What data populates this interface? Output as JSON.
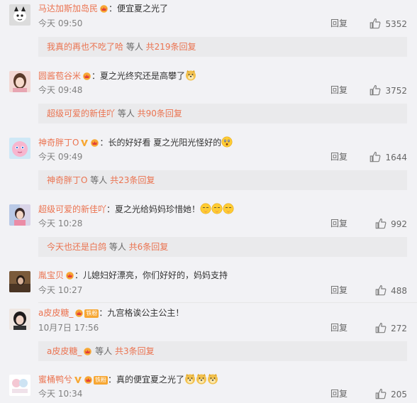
{
  "comments": [
    {
      "username": "马达加斯加岛民",
      "text": "：便宜夏之光了",
      "time": "今天 09:50",
      "reply_label": "回复",
      "likes": "5352",
      "sub": {
        "user": "我真的再也不吃了哈",
        "mid": " 等人 ",
        "count": "共219条回复"
      }
    },
    {
      "username": "圆酱苞谷米",
      "text": "：夏之光终究还是高攀了",
      "time": "今天 09:48",
      "reply_label": "回复",
      "likes": "3752",
      "sub": {
        "user": "超级可爱的新佳吖",
        "mid": " 等人 ",
        "count": "共90条回复"
      }
    },
    {
      "username": "神奇胖丁O",
      "text": "：长的好好看 夏之光阳光怪好的",
      "time": "今天 09:49",
      "reply_label": "回复",
      "likes": "1644",
      "sub": {
        "user": "神奇胖丁O",
        "mid": " 等人 ",
        "count": "共23条回复"
      }
    },
    {
      "username": "超级可爱的新佳吖",
      "text": "：夏之光给妈妈珍惜她！",
      "time": "今天 10:28",
      "reply_label": "回复",
      "likes": "992",
      "sub": {
        "user": "今天也还是白鸽",
        "mid": " 等人 ",
        "count": "共6条回复"
      }
    },
    {
      "username": "胤宝贝",
      "text": "：儿媳妇好漂亮，你们好好的，妈妈支持",
      "time": "今天 10:27",
      "reply_label": "回复",
      "likes": "488"
    },
    {
      "username": "a皮皮糖_",
      "fan_badge": "铁粉",
      "text": "：九宫格诶公主公主！",
      "time": "10月7日 17:56",
      "reply_label": "回复",
      "likes": "272",
      "sub": {
        "user": "a皮皮糖_",
        "mid": " 等人 ",
        "count": "共3条回复"
      }
    },
    {
      "username": "蜜桶鸭兮",
      "fan_badge": "铁粉",
      "text": "：真的便宜夏之光了",
      "time": "今天 10:34",
      "reply_label": "回复",
      "likes": "205"
    }
  ],
  "colors": {
    "link": "#eb7350",
    "meta": "#808080",
    "sub_bg": "#eaeaec"
  }
}
